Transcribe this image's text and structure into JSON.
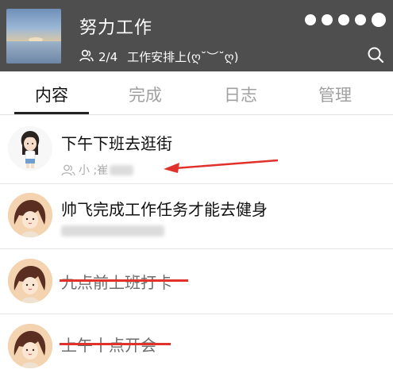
{
  "header": {
    "group_title": "努力工作",
    "member_count": "2/4",
    "subtitle": "工作安排上(ღ˘︶˘ღ)",
    "menu_icon": "more-dots-icon",
    "search_icon": "search-icon"
  },
  "tabs": [
    {
      "label": "内容",
      "active": true
    },
    {
      "label": "完成",
      "active": false
    },
    {
      "label": "日志",
      "active": false
    },
    {
      "label": "管理",
      "active": false
    }
  ],
  "tasks": [
    {
      "title": "下午下班去逛街",
      "done": false,
      "members": "小  ;崔",
      "avatar": "girl-cartoon-avatar"
    },
    {
      "title": "帅飞完成工作任务才能去健身",
      "done": false,
      "members": "",
      "avatar": "anime-girl-avatar"
    },
    {
      "title": "九点前上班打卡",
      "done": true,
      "members": "",
      "avatar": "anime-girl-avatar"
    },
    {
      "title": "上午十点开会",
      "done": true,
      "members": "",
      "avatar": "anime-girl-avatar"
    }
  ],
  "colors": {
    "header_bg": "#4e4e4e",
    "strike": "#e0312b",
    "arrow": "#e0312b"
  }
}
